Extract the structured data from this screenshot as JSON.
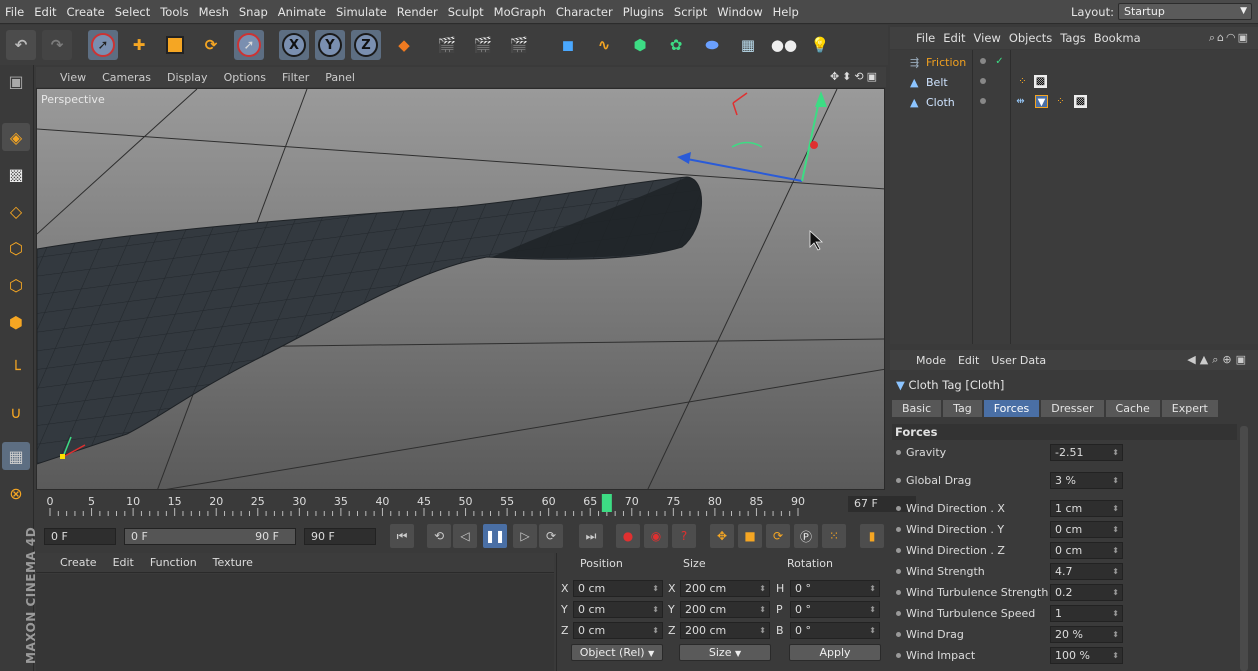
{
  "menu": [
    "File",
    "Edit",
    "Create",
    "Select",
    "Tools",
    "Mesh",
    "Snap",
    "Animate",
    "Simulate",
    "Render",
    "Sculpt",
    "MoGraph",
    "Character",
    "Plugins",
    "Script",
    "Window",
    "Help"
  ],
  "layout": {
    "label": "Layout:",
    "value": "Startup"
  },
  "viewport": {
    "menu": [
      "View",
      "Cameras",
      "Display",
      "Options",
      "Filter",
      "Panel"
    ],
    "label": "Perspective"
  },
  "timeline": {
    "ticks": [
      "0",
      "5",
      "10",
      "15",
      "20",
      "25",
      "30",
      "35",
      "40",
      "45",
      "50",
      "55",
      "60",
      "65",
      "70",
      "75",
      "80",
      "85",
      "90"
    ],
    "current_frame": "67 F",
    "playhead_frame": 67,
    "start": "0 F",
    "range_start": "0 F",
    "range_end": "90 F",
    "end": "90 F"
  },
  "material_manager": {
    "menu": [
      "Create",
      "Edit",
      "Function",
      "Texture"
    ]
  },
  "coordinates": {
    "headers": {
      "position": "Position",
      "size": "Size",
      "rotation": "Rotation"
    },
    "rows": [
      {
        "axis": "X",
        "pos": "0 cm",
        "saxis": "X",
        "size": "200 cm",
        "raxis": "H",
        "rot": "0 °"
      },
      {
        "axis": "Y",
        "pos": "0 cm",
        "saxis": "Y",
        "size": "200 cm",
        "raxis": "P",
        "rot": "0 °"
      },
      {
        "axis": "Z",
        "pos": "0 cm",
        "saxis": "Z",
        "size": "200 cm",
        "raxis": "B",
        "rot": "0 °"
      }
    ],
    "mode": "Object (Rel)",
    "size_mode": "Size",
    "apply": "Apply"
  },
  "object_manager": {
    "menu": [
      "File",
      "Edit",
      "View",
      "Objects",
      "Tags",
      "Bookma"
    ],
    "objects": [
      {
        "name": "Friction",
        "color": "#f0a020"
      },
      {
        "name": "Belt",
        "color": "#cfe4ff"
      },
      {
        "name": "Cloth",
        "color": "#cfe4ff"
      }
    ]
  },
  "attribute_manager": {
    "menu": [
      "Mode",
      "Edit",
      "User Data"
    ],
    "title": "Cloth Tag [Cloth]",
    "tabs": [
      "Basic",
      "Tag",
      "Forces",
      "Dresser",
      "Cache",
      "Expert"
    ],
    "selected_tab": "Forces",
    "section": "Forces",
    "params": [
      {
        "label": "Gravity",
        "value": "-2.51"
      },
      {
        "label": "Global Drag",
        "value": "3 %"
      },
      {
        "label": "Wind Direction . X",
        "value": "1 cm"
      },
      {
        "label": "Wind Direction . Y",
        "value": "0 cm"
      },
      {
        "label": "Wind Direction . Z",
        "value": "0 cm"
      },
      {
        "label": "Wind Strength",
        "value": "4.7"
      },
      {
        "label": "Wind Turbulence Strength",
        "value": "0.2"
      },
      {
        "label": "Wind Turbulence Speed",
        "value": "1"
      },
      {
        "label": "Wind Drag",
        "value": "20 %"
      },
      {
        "label": "Wind Impact",
        "value": "100 %"
      }
    ]
  },
  "toolbar_axes": [
    "X",
    "Y",
    "Z"
  ],
  "brand": "MAXON CINEMA 4D",
  "colors": {
    "accent": "#4a6fa5",
    "friction": "#f0a020",
    "playhead": "#3ddc84"
  }
}
